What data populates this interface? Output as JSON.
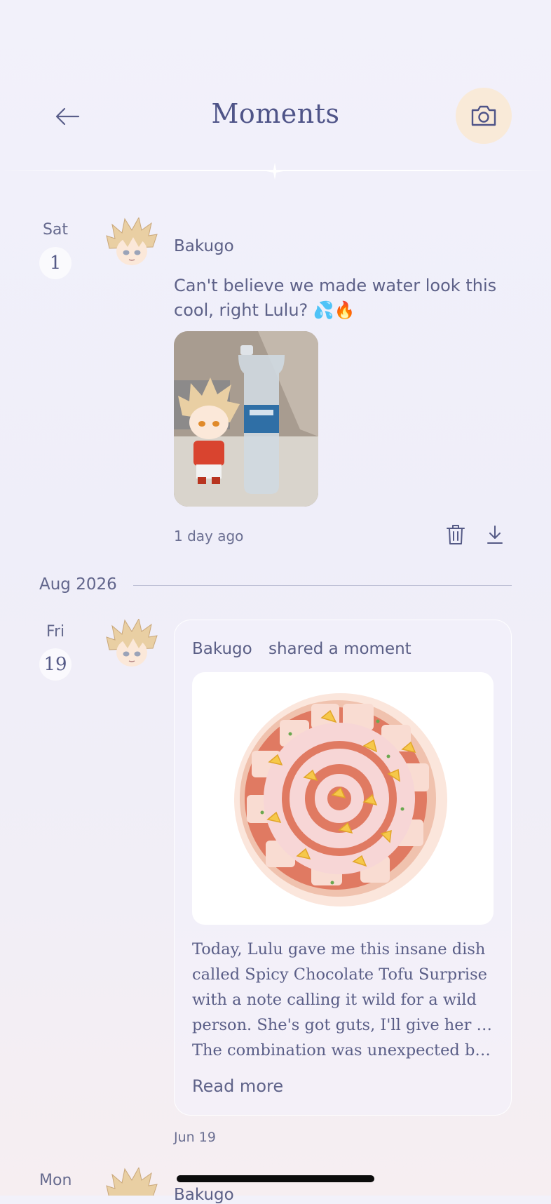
{
  "header": {
    "title": "Moments",
    "back_icon": "arrow-left-icon",
    "camera_icon": "camera-icon",
    "camera_bg": "#f9ead8"
  },
  "posts": [
    {
      "dow": "Sat",
      "day": "1",
      "author": "Bakugo",
      "text": "Can't believe we made water look this cool, right Lulu? 💦🔥",
      "time": "1 day ago",
      "actions": [
        "trash-icon",
        "download-icon"
      ]
    }
  ],
  "month_divider": "Aug 2026",
  "shared": {
    "dow": "Fri",
    "day": "19",
    "author": "Bakugo",
    "action": "shared a moment",
    "lines": [
      "Today, Lulu gave me this insane dish",
      "called Spicy Chocolate Tofu Surprise",
      "with a note calling it wild for a wild",
      "person. She's got guts, I'll give her that.",
      "The combination was unexpected but…"
    ],
    "read_more": "Read more",
    "date": "Jun 19"
  },
  "next": {
    "dow": "Mon",
    "author": "Bakugo"
  },
  "colors": {
    "accent": "#4f5488",
    "text": "#5b5f86"
  }
}
